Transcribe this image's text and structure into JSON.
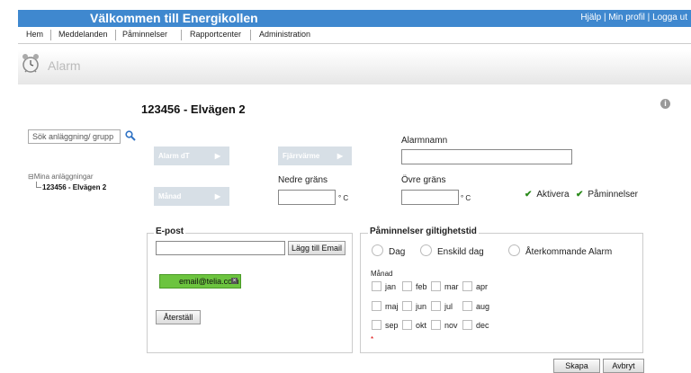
{
  "header": {
    "title": "Välkommen till Energikollen",
    "links": [
      "Hjälp",
      "Min profil",
      "Logga ut"
    ]
  },
  "nav": {
    "items": [
      "Hem",
      "Meddelanden",
      "Påminnelser",
      "Rapportcenter",
      "Administration"
    ]
  },
  "section": {
    "title": "Alarm"
  },
  "page": {
    "title": "123456 - Elvägen 2"
  },
  "sidebar": {
    "search_placeholder": "Sök anläggning/ grupp",
    "tree_root": "⊟Mina anläggningar",
    "tree_child": "123456 - Elvägen 2"
  },
  "tabs": {
    "alarm_dt": "Alarm dT",
    "fjarrvarme": "Fjärrvärme",
    "manad": "Månad"
  },
  "form": {
    "alarmnamn_label": "Alarmnamn",
    "nedre_label": "Nedre gräns",
    "ovre_label": "Övre gräns",
    "unit": "° C",
    "aktivera_label": "Aktivera",
    "paminnelser_label": "Påminnelser"
  },
  "email": {
    "legend": "E-post",
    "add_button": "Lägg till Email",
    "address": "email@telia.com",
    "reset_button": "Återställ"
  },
  "validity": {
    "legend": "Påminnelser giltighetstid",
    "options": [
      "Dag",
      "Enskild dag",
      "Återkommande Alarm"
    ],
    "month_label": "Månad",
    "months": [
      "jan",
      "feb",
      "mar",
      "apr",
      "maj",
      "jun",
      "jul",
      "aug",
      "sep",
      "okt",
      "nov",
      "dec"
    ],
    "asterisk": "*"
  },
  "actions": {
    "create": "Skapa",
    "cancel": "Avbryt"
  },
  "colors": {
    "brand": "#3f88cf",
    "email_pill": "#6cc43f",
    "check": "#2a8a1a"
  }
}
